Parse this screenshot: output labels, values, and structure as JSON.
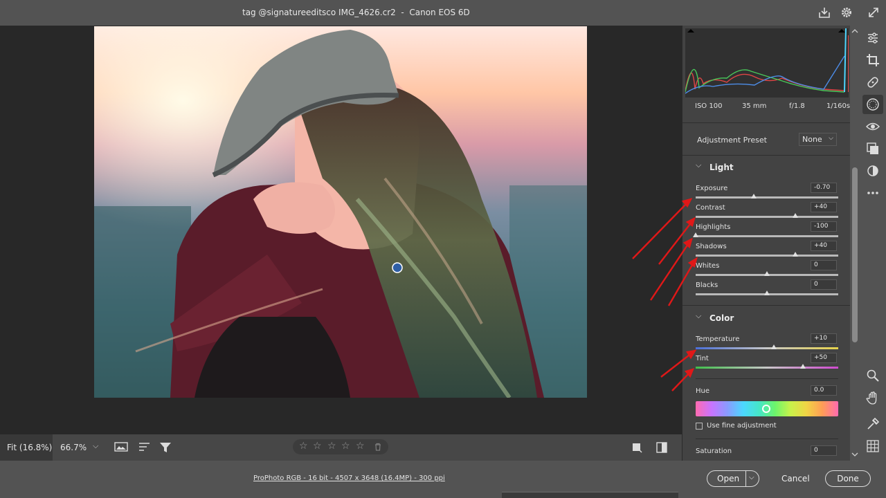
{
  "window": {
    "title": "tag @signatureeditsco IMG_4626.cr2  -  Canon EOS 6D",
    "icons": [
      "save-icon",
      "gear-icon",
      "expand-icon"
    ]
  },
  "canvas_bar": {
    "fit_label": "Fit (16.8%)",
    "zoom_label": "66.7%",
    "rating_stars": 0,
    "icons": [
      "preview-icon",
      "sort-icon",
      "filter-icon",
      "sampler-icon",
      "compare-icon"
    ]
  },
  "exif": {
    "iso": "ISO 100",
    "focal": "35 mm",
    "aperture": "f/1.8",
    "shutter": "1/160s"
  },
  "adjustment_preset": {
    "label": "Adjustment Preset",
    "value": "None"
  },
  "light": {
    "title": "Light",
    "sliders": [
      {
        "label": "Exposure",
        "value": "-0.70",
        "position": 0.41
      },
      {
        "label": "Contrast",
        "value": "+40",
        "position": 0.7
      },
      {
        "label": "Highlights",
        "value": "-100",
        "position": 0.0
      },
      {
        "label": "Shadows",
        "value": "+40",
        "position": 0.7
      },
      {
        "label": "Whites",
        "value": "0",
        "position": 0.5
      },
      {
        "label": "Blacks",
        "value": "0",
        "position": 0.5
      }
    ]
  },
  "color": {
    "title": "Color",
    "sliders": [
      {
        "label": "Temperature",
        "value": "+10",
        "position": 0.55
      },
      {
        "label": "Tint",
        "value": "+50",
        "position": 0.75
      }
    ],
    "hue": {
      "label": "Hue",
      "value": "0.0",
      "position": 0.5
    },
    "fine_adjustment": {
      "label": "Use fine adjustment",
      "checked": false
    },
    "saturation": {
      "label": "Saturation",
      "value": "0"
    }
  },
  "status": {
    "workflow": "ProPhoto RGB - 16 bit - 4507 x 3648 (16.4MP) - 300 ppi",
    "open_label": "Open",
    "cancel_label": "Cancel",
    "done_label": "Done"
  },
  "tools": [
    "edit-sliders-icon",
    "crop-icon",
    "healing-icon",
    "masking-icon",
    "red-eye-icon",
    "presets-icon",
    "snapshots-icon",
    "more-icon",
    "zoom-icon",
    "hand-icon",
    "color-sampler-icon",
    "grid-icon"
  ],
  "colors": {
    "accent_arrow": "#e01818",
    "panel_bg": "#434343",
    "canvas_bg": "#282828"
  }
}
